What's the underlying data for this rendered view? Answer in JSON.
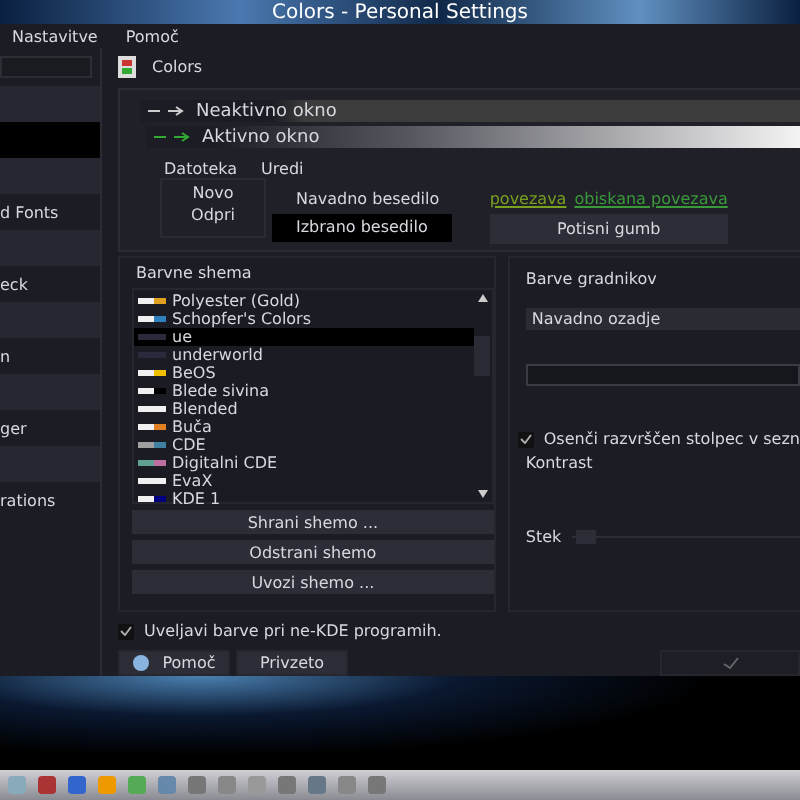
{
  "window": {
    "title": "Colors - Personal Settings"
  },
  "menu": [
    "Nastavitve",
    "Pomoč"
  ],
  "sidebar": {
    "items": [
      {
        "selected": false
      },
      {
        "selected": true
      },
      {
        "selected": false
      },
      {
        "label": "d Fonts",
        "selected": false
      },
      {
        "selected": false
      },
      {
        "label": "eck",
        "selected": false
      },
      {
        "selected": false
      },
      {
        "label": "n",
        "selected": false
      },
      {
        "selected": false
      },
      {
        "label": "ger",
        "selected": false
      },
      {
        "selected": false
      },
      {
        "label": "rations",
        "selected": false
      }
    ]
  },
  "module": {
    "title": "Colors"
  },
  "preview": {
    "inactive_title": "Neaktivno okno",
    "active_title": "Aktivno okno",
    "menu": [
      "Datoteka",
      "Uredi"
    ],
    "menu_items": [
      "Novo",
      "Odpri"
    ],
    "normal_text": "Navadno besedilo",
    "selected_text": "Izbrano besedilo",
    "link": "povezava",
    "visited_link": "obiskana povezava",
    "push_button": "Potisni gumb"
  },
  "schemes": {
    "title": "Barvne shema",
    "items": [
      {
        "name": "Polyester (Gold)",
        "swatch": [
          {
            "color": "#f0f0f0"
          },
          {
            "color": "#e0a020"
          }
        ],
        "selected": false
      },
      {
        "name": "Schopfer's Colors",
        "swatch": [
          {
            "color": "#f0f0f0"
          },
          {
            "color": "#3080c0"
          }
        ],
        "selected": false
      },
      {
        "name": "ue",
        "swatch": [
          {
            "color": "#2a2a3c"
          },
          {
            "color": "#2a2a3c"
          }
        ],
        "selected": true
      },
      {
        "name": "underworld",
        "swatch": [
          {
            "color": "#2a2a3c"
          },
          {
            "color": "#2a2a3c"
          }
        ],
        "selected": false
      },
      {
        "name": "BeOS",
        "swatch": [
          {
            "color": "#f0f0f0"
          },
          {
            "color": "#f0c000"
          }
        ],
        "selected": false
      },
      {
        "name": "Blede sivina",
        "swatch": [
          {
            "color": "#f0f0f0"
          },
          {
            "color": "#000000"
          }
        ],
        "selected": false
      },
      {
        "name": "Blended",
        "swatch": [
          {
            "color": "#f0f0f0"
          },
          {
            "color": "#f0f0f0"
          }
        ],
        "selected": false
      },
      {
        "name": "Buča",
        "swatch": [
          {
            "color": "#f0f0f0"
          },
          {
            "color": "#e08020"
          }
        ],
        "selected": false
      },
      {
        "name": "CDE",
        "swatch": [
          {
            "color": "#a0a0a0"
          },
          {
            "color": "#4080a0"
          }
        ],
        "selected": false
      },
      {
        "name": "Digitalni CDE",
        "swatch": [
          {
            "color": "#60a090"
          },
          {
            "color": "#c070a0"
          }
        ],
        "selected": false
      },
      {
        "name": "EvaX",
        "swatch": [
          {
            "color": "#f0f0f0"
          },
          {
            "color": "#f0f0f0"
          }
        ],
        "selected": false
      },
      {
        "name": "KDE 1",
        "swatch": [
          {
            "color": "#f0f0f0"
          },
          {
            "color": "#000080"
          }
        ],
        "selected": false
      }
    ],
    "buttons": [
      "Shrani shemo ...",
      "Odstrani shemo",
      "Uvozi shemo ..."
    ]
  },
  "widgets": {
    "title": "Barve gradnikov",
    "combo": "Navadno ozadje",
    "shade_checkbox": {
      "label": "Osenči razvrščen stolpec v sezn",
      "checked": true
    },
    "contrast_title": "Kontrast",
    "contrast_label": "Stek",
    "level": 0.02
  },
  "apply_checkbox": {
    "label": "Uveljavi barve pri ne-KDE programih.",
    "checked": true
  },
  "buttons": [
    {
      "label": "Pomoč",
      "kind": "help",
      "disabled": false
    },
    {
      "label": "Privzeto",
      "kind": "plain",
      "disabled": false
    },
    {
      "kind": "apply",
      "disabled": true
    }
  ]
}
